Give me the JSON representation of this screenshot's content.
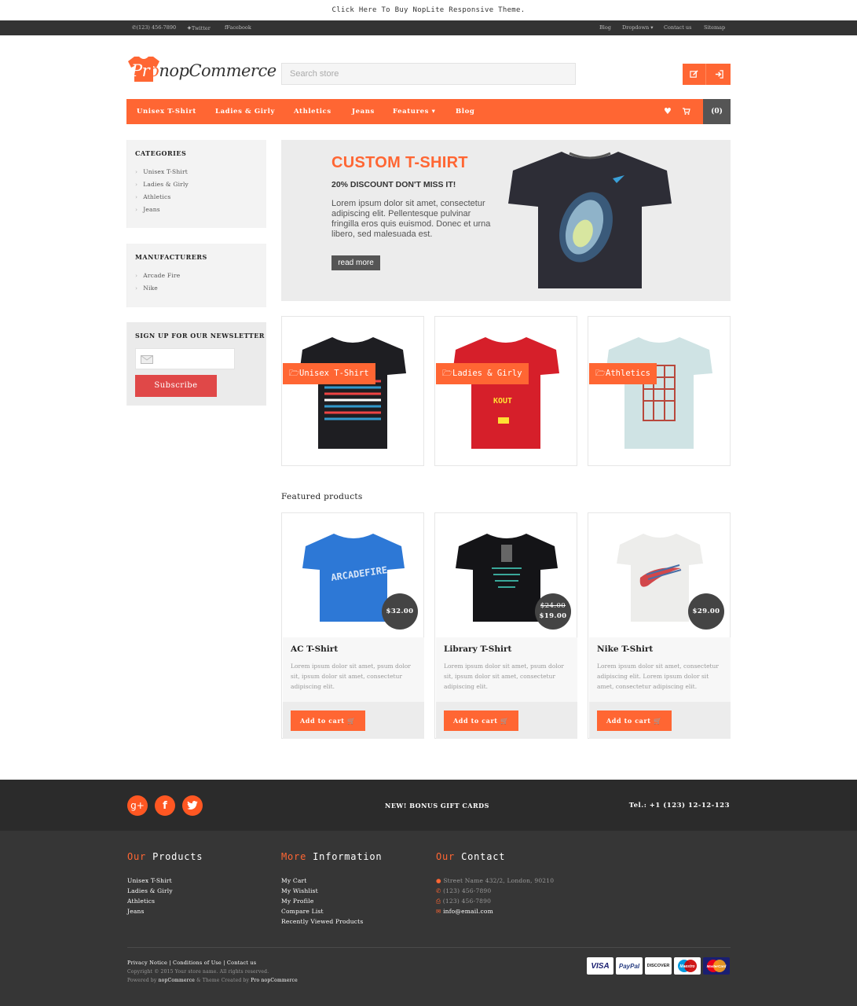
{
  "promo": "Click Here To Buy NopLite Responsive Theme.",
  "topbar": {
    "phone": "(123) 456-7890",
    "twitter": "Twitter",
    "facebook": "Facebook",
    "links": [
      "Blog",
      "Dropdown",
      "Contact us",
      "Sitemap"
    ]
  },
  "header": {
    "logo_text": "PronopCommerce",
    "search_placeholder": "Search store"
  },
  "nav": {
    "items": [
      "Unisex T-Shirt",
      "Ladies & Girly",
      "Athletics",
      "Jeans",
      "Features",
      "Blog"
    ],
    "cart_count": "(0)"
  },
  "sidebar": {
    "categories_title": "CATEGORIES",
    "categories": [
      "Unisex T-Shirt",
      "Ladies & Girly",
      "Athletics",
      "Jeans"
    ],
    "manufacturers_title": "MANUFACTURERS",
    "manufacturers": [
      "Arcade Fire",
      "Nike"
    ],
    "newsletter_title": "SIGN UP FOR OUR NEWSLETTER",
    "subscribe": "Subscribe"
  },
  "slider": {
    "title": "CUSTOM T-SHIRT",
    "subtitle": "20% DISCOUNT DON'T MISS IT!",
    "text": "Lorem ipsum dolor sit amet, consectetur adipiscing elit. Pellentesque pulvinar fringilla eros quis euismod. Donec et urna libero, sed malesuada est.",
    "button": "read more"
  },
  "categories_grid": [
    "Unisex T-Shirt",
    "Ladies & Girly",
    "Athletics"
  ],
  "featured": {
    "title": "Featured products",
    "products": [
      {
        "name": "AC T-Shirt",
        "price": "$32.00",
        "old": "",
        "desc": "Lorem ipsum dolor sit amet, psum dolor sit, ipsum dolor sit amet, consectetur adipiscing elit.",
        "cart": "Add to cart"
      },
      {
        "name": "Library T-Shirt",
        "price": "$19.00",
        "old": "$24.00",
        "desc": "Lorem ipsum dolor sit amet, psum dolor sit, ipsum dolor sit amet, consectetur adipiscing elit.",
        "cart": "Add to cart"
      },
      {
        "name": "Nike T-Shirt",
        "price": "$29.00",
        "old": "",
        "desc": "Lorem ipsum dolor sit amet, consectetur adipiscing elit. Lorem ipsum dolor sit amet, consectetur adipiscing elit.",
        "cart": "Add to cart"
      }
    ]
  },
  "footer": {
    "gift": "NEW! BONUS GIFT CARDS",
    "tel": "Tel.: +1 (123) 12-12-123",
    "products_title_a": "Our",
    "products_title_b": "Products",
    "products": [
      "Unisex T-Shirt",
      "Ladies & Girly",
      "Athletics",
      "Jeans"
    ],
    "info_title_a": "More",
    "info_title_b": "Information",
    "info": [
      "My Cart",
      "My Wishlist",
      "My Profile",
      "Compare List",
      "Recently Viewed Products"
    ],
    "contact_title_a": "Our",
    "contact_title_b": "Contact",
    "contact": [
      "Street Name 432/2, London, 90210",
      "(123) 456-7890",
      "(123) 456-7890",
      "info@email.com"
    ],
    "bottom_links": [
      "Privacy Notice",
      "Conditions of Use",
      "Contact us"
    ],
    "copyright": "Copyright © 2015 Your store name. All rights reserved.",
    "powered_a": "Powered by",
    "powered_b": "nopCommerce",
    "powered_c": "& Theme Created by",
    "powered_d": "Pro nopCommerce",
    "cards": [
      "VISA",
      "PayPal",
      "DISCOVER",
      "Maestro",
      "MasterCard"
    ]
  },
  "colors": {
    "accent": "#ff6633",
    "dark": "#2b2b2b",
    "footer": "#363636"
  }
}
